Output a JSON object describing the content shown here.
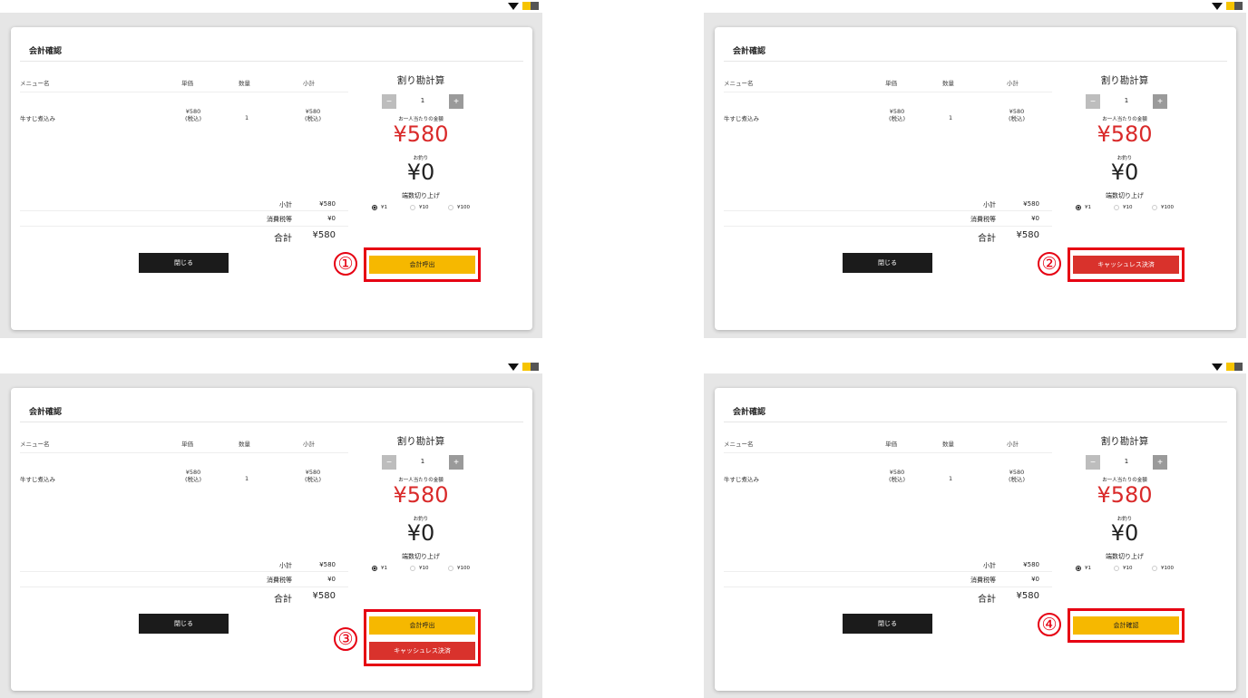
{
  "screen": {
    "title": "会計確認",
    "columns": {
      "name": "メニュー名",
      "price": "単価",
      "qty": "数量",
      "subtotal": "小計"
    },
    "item": {
      "name": "牛すじ煮込み",
      "price": "¥580",
      "tax_note": "(税込)",
      "qty": "1",
      "subtotal": "¥580"
    },
    "summary": {
      "subtotal_label": "小計",
      "subtotal_value": "¥580",
      "tax_label": "消費税等",
      "tax_value": "¥0",
      "total_label": "合計",
      "total_value": "¥580"
    },
    "close_label": "閉じる",
    "split": {
      "title": "割り勘計算",
      "minus": "−",
      "plus": "+",
      "count": "1",
      "per_person_label": "お一人当たりの金額",
      "per_person_amount": "¥580",
      "change_label": "お釣り",
      "change_amount": "¥0",
      "rounding_label": "端数切り上げ",
      "rounding_options": [
        "¥1",
        "¥10",
        "¥100"
      ],
      "selected_rounding": "¥1"
    }
  },
  "panels": [
    {
      "step": "①",
      "buttons": [
        "会計呼出"
      ]
    },
    {
      "step": "②",
      "buttons": [
        "キャッシュレス決済"
      ]
    },
    {
      "step": "③",
      "buttons": [
        "会計呼出",
        "キャッシュレス決済"
      ]
    },
    {
      "step": "④",
      "buttons": [
        "会計確認"
      ]
    }
  ],
  "colors": {
    "accent_yellow": "#f6b800",
    "accent_red": "#d9322c",
    "highlight_frame": "#e60012",
    "amount_red": "#d92a2a"
  }
}
